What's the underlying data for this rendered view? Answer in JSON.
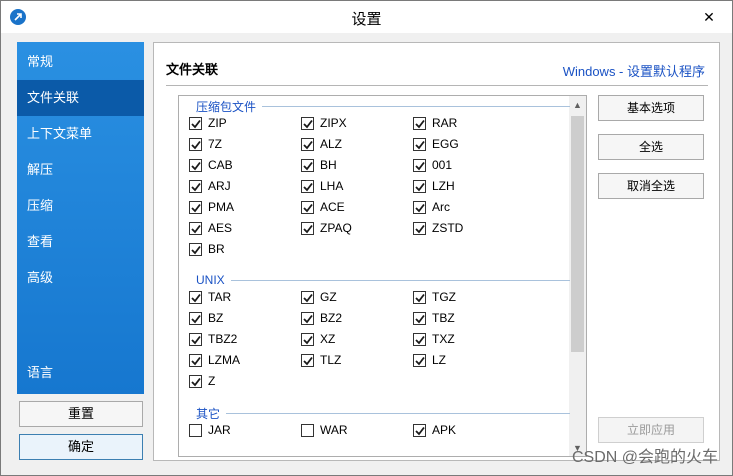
{
  "window": {
    "title": "设置"
  },
  "sidebar": {
    "items": [
      {
        "label": "常规",
        "active": false
      },
      {
        "label": "文件关联",
        "active": true
      },
      {
        "label": "上下文菜单",
        "active": false
      },
      {
        "label": "解压",
        "active": false
      },
      {
        "label": "压缩",
        "active": false
      },
      {
        "label": "查看",
        "active": false
      },
      {
        "label": "高级",
        "active": false
      }
    ],
    "language_label": "语言",
    "reset_label": "重置",
    "ok_label": "确定"
  },
  "main": {
    "section_title": "文件关联",
    "windows_link": "Windows - 设置默认程序",
    "groups": [
      {
        "title": "压缩包文件",
        "items": [
          {
            "label": "ZIP",
            "checked": true
          },
          {
            "label": "ZIPX",
            "checked": true
          },
          {
            "label": "RAR",
            "checked": true
          },
          {
            "label": "7Z",
            "checked": true
          },
          {
            "label": "ALZ",
            "checked": true
          },
          {
            "label": "EGG",
            "checked": true
          },
          {
            "label": "CAB",
            "checked": true
          },
          {
            "label": "BH",
            "checked": true
          },
          {
            "label": "001",
            "checked": true
          },
          {
            "label": "ARJ",
            "checked": true
          },
          {
            "label": "LHA",
            "checked": true
          },
          {
            "label": "LZH",
            "checked": true
          },
          {
            "label": "PMA",
            "checked": true
          },
          {
            "label": "ACE",
            "checked": true
          },
          {
            "label": "Arc",
            "checked": true
          },
          {
            "label": "AES",
            "checked": true
          },
          {
            "label": "ZPAQ",
            "checked": true
          },
          {
            "label": "ZSTD",
            "checked": true
          },
          {
            "label": "BR",
            "checked": true
          }
        ]
      },
      {
        "title": "UNIX",
        "items": [
          {
            "label": "TAR",
            "checked": true
          },
          {
            "label": "GZ",
            "checked": true
          },
          {
            "label": "TGZ",
            "checked": true
          },
          {
            "label": "BZ",
            "checked": true
          },
          {
            "label": "BZ2",
            "checked": true
          },
          {
            "label": "TBZ",
            "checked": true
          },
          {
            "label": "TBZ2",
            "checked": true
          },
          {
            "label": "XZ",
            "checked": true
          },
          {
            "label": "TXZ",
            "checked": true
          },
          {
            "label": "LZMA",
            "checked": true
          },
          {
            "label": "TLZ",
            "checked": true
          },
          {
            "label": "LZ",
            "checked": true
          },
          {
            "label": "Z",
            "checked": true
          }
        ]
      },
      {
        "title": "其它",
        "items": [
          {
            "label": "JAR",
            "checked": false
          },
          {
            "label": "WAR",
            "checked": false
          },
          {
            "label": "APK",
            "checked": true
          }
        ]
      }
    ],
    "buttons": {
      "basic": "基本选项",
      "select_all": "全选",
      "deselect_all": "取消全选",
      "apply": "立即应用"
    }
  },
  "watermark": "CSDN @会跑的火车",
  "colors": {
    "sidebar": "#1f86d9",
    "sidebar_active": "#0b5aa8",
    "link": "#1a52c4"
  }
}
